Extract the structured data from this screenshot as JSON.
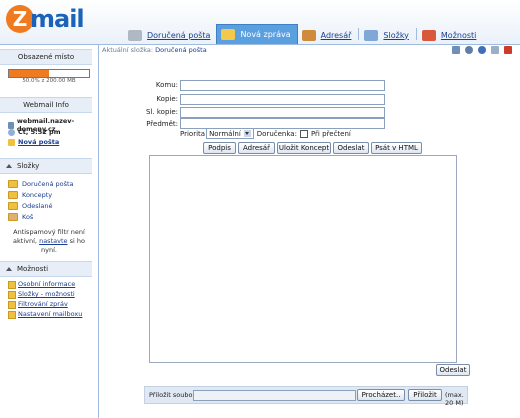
{
  "brand": {
    "z": "Z",
    "name": "mail"
  },
  "tabs": [
    {
      "label": "Doručená pošta",
      "icon": "inbox-icon",
      "color": "#b0b8c4",
      "active": false
    },
    {
      "label": "Nová zpráva",
      "icon": "compose-icon",
      "color": "#f2c94c",
      "active": true
    },
    {
      "label": "Adresář",
      "icon": "addressbook-icon",
      "color": "#d08a3c",
      "active": false
    },
    {
      "label": "Složky",
      "icon": "folders-icon",
      "color": "#7fa7d8",
      "active": false
    },
    {
      "label": "Možnosti",
      "icon": "tools-icon",
      "color": "#d9573a",
      "active": false
    }
  ],
  "sidebar": {
    "quota_title": "Obsazené místo",
    "quota_text": "50.0% z 200.00 MB",
    "quota_fraction": 0.5,
    "webmail_title": "Webmail Info",
    "host": "webmail.nazev-domeny.cz",
    "time": "Čt, 5:52 pm",
    "new_mail": "Nová pošta",
    "folders_title": "Složky",
    "folders": [
      "Doručená pošta",
      "Koncepty",
      "Odeslané",
      "Koš"
    ],
    "antispam_pre": "Antispamový filtr není aktivní,",
    "antispam_link": "nastavte",
    "antispam_post": "si ho nyní.",
    "options_title": "Možnosti",
    "options": [
      "Osobní informace",
      "Složky - možnosti",
      "Filtrování zpráv",
      "Nastavení mailboxu"
    ]
  },
  "crumb": {
    "label": "Aktuální složka:",
    "value": "Doručená pošta"
  },
  "form": {
    "to_label": "Komu:",
    "cc_label": "Kopie:",
    "bcc_label": "Sl. kopie:",
    "subject_label": "Předmět:",
    "to": "",
    "cc": "",
    "bcc": "",
    "subject": "",
    "priority_label": "Priorita",
    "priority_value": "Normální",
    "receipt_label": "Doručenka:",
    "read_label": "Při přečtení",
    "read_checked": false
  },
  "buttons": {
    "signature": "Podpis",
    "addresses": "Adresář",
    "save_draft": "Uložit Koncept",
    "send": "Odeslat",
    "html": "Psát v HTML",
    "send_bottom": "Odeslat"
  },
  "attach": {
    "label": "Přiložit soubor:",
    "browse": "Procházet..",
    "attach": "Přiložit",
    "max": "(max. 20 M)"
  }
}
